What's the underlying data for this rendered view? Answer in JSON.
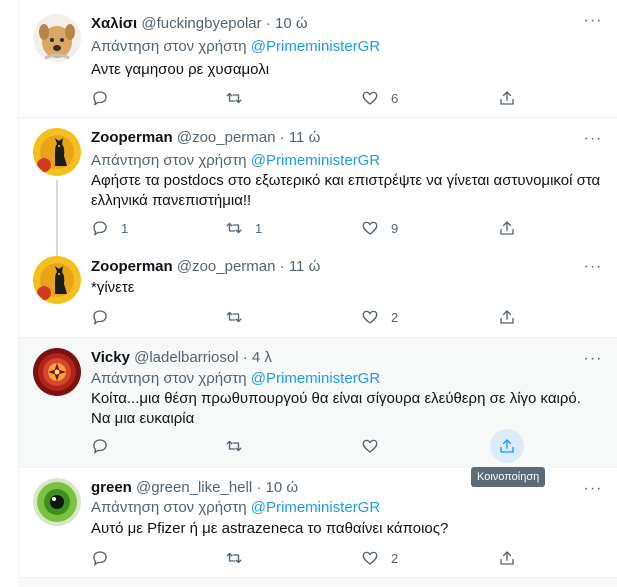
{
  "reply_prefix": "Απάντηση στον χρήστη",
  "tooltip": "Κοινοποίηση",
  "tweets": [
    {
      "name": "Χαλίσι",
      "handle": "@fuckingbyepolar",
      "time": "10 ώ",
      "reply_to": "@PrimeministerGR",
      "text": "Αντε γαμησου ρε χυσαμολι",
      "replies": "",
      "retweets": "",
      "likes": "6",
      "avatar": "dog-avatar"
    },
    {
      "name": "Zooperman",
      "handle": "@zoo_perman",
      "time": "11 ώ",
      "reply_to": "@PrimeministerGR",
      "text": "Αφήστε τα postdocs στο εξωτερικό και επιστρέψτε να γίνεται αστυνομικοί στα ελληνικά πανεπιστήμια!!",
      "replies": "1",
      "retweets": "1",
      "likes": "9",
      "avatar": "cat-avatar"
    },
    {
      "name": "Zooperman",
      "handle": "@zoo_perman",
      "time": "11 ώ",
      "text": "*γίνετε",
      "replies": "",
      "retweets": "",
      "likes": "2",
      "avatar": "cat-avatar"
    },
    {
      "name": "Vicky",
      "handle": "@ladelbarriosol",
      "time": "4 λ",
      "reply_to": "@PrimeministerGR",
      "text": "Κοίτα...μια θέση πρωθυπουργού θα είναι σίγουρα ελεύθερη σε λίγο καιρό. Να μια ευκαιρία",
      "replies": "",
      "retweets": "",
      "likes": "",
      "avatar": "mandala-avatar"
    },
    {
      "name": "green",
      "handle": "@green_like_hell",
      "time": "10 ώ",
      "reply_to": "@PrimeministerGR",
      "text": "Αυτό με Pfizer  ή με astrazeneca το παθαίνει κάποιος?",
      "replies": "",
      "retweets": "",
      "likes": "2",
      "avatar": "eye-avatar"
    }
  ]
}
